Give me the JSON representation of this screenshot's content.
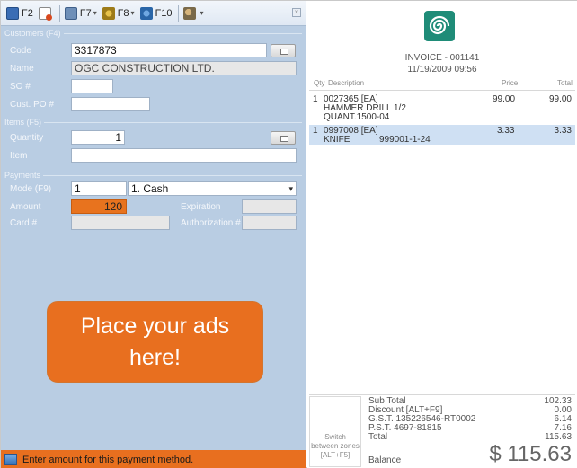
{
  "toolbar": {
    "btn_f2": "F2",
    "btn_f7": "F7",
    "btn_f8": "F8",
    "btn_f10": "F10"
  },
  "customers": {
    "section_title": "Customers (F4)",
    "code_label": "Code",
    "code_value": "3317873",
    "name_label": "Name",
    "name_value": "OGC CONSTRUCTION LTD.",
    "so_label": "SO #",
    "so_value": "",
    "cust_po_label": "Cust. PO #",
    "cust_po_value": ""
  },
  "items": {
    "section_title": "Items (F5)",
    "quantity_label": "Quantity",
    "quantity_value": "1",
    "item_label": "Item",
    "item_value": ""
  },
  "payments": {
    "section_title": "Payments",
    "mode_label": "Mode (F9)",
    "mode_code": "1",
    "mode_value": "1. Cash",
    "amount_label": "Amount",
    "amount_value": "120",
    "expiration_label": "Expiration",
    "expiration_value": "",
    "card_label": "Card #",
    "card_value": "",
    "authorization_label": "Authorization #",
    "authorization_value": ""
  },
  "ad": {
    "line1": "Place your ads",
    "line2": "here!"
  },
  "status": {
    "message": "Enter amount for this payment method."
  },
  "invoice": {
    "number": "INVOICE - 001141",
    "datetime": "11/19/2009 09:56",
    "columns": {
      "qty": "Qty",
      "description": "Description",
      "price": "Price",
      "total": "Total"
    },
    "lines": [
      {
        "qty": "1",
        "desc1": "0027365 [EA]",
        "desc2": "HAMMER DRILL 1/2",
        "desc3": "QUANT.1500-04",
        "price": "99.00",
        "total": "99.00"
      },
      {
        "qty": "1",
        "desc1": "0997008 [EA]",
        "desc2": "KNIFE",
        "desc3": "999001-1-24",
        "price": "3.33",
        "total": "3.33"
      }
    ]
  },
  "totals": {
    "switch_text": "Switch between zones [ALT+F5]",
    "subtotal_label": "Sub Total",
    "subtotal_value": "102.33",
    "discount_label": "Discount [ALT+F9]",
    "discount_value": "0.00",
    "gst_label": "G.S.T. 135226546-RT0002",
    "gst_value": "6.14",
    "pst_label": "P.S.T. 4697-81815",
    "pst_value": "7.16",
    "total_label": "Total",
    "total_value": "115.63",
    "balance_label": "Balance",
    "balance_value": "$ 115.63"
  }
}
